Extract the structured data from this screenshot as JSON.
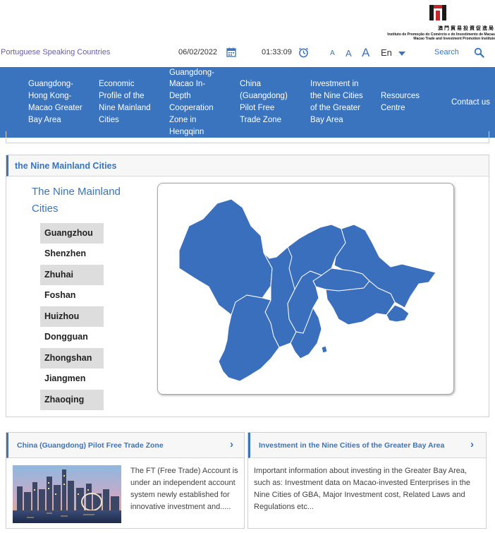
{
  "logo": {
    "chinese_name": "澳門貿易投資促進局",
    "portuguese_name": "Instituto de Promoção do Comércio e do Investimento de Macau",
    "english_name": "Macao Trade and Investment Promotion Institute"
  },
  "topbar": {
    "portuguese_link": "Portuguese Speaking Countries",
    "date": "06/02/2022",
    "time": "01:33:09",
    "font_small": "A",
    "font_medium": "A",
    "font_large": "A",
    "language": "En",
    "search_label": "Search"
  },
  "nav": {
    "items": [
      {
        "label": "Guangdong-Hong Kong-Macao Greater Bay Area"
      },
      {
        "label": "Economic Profile of the Nine Mainland Cities"
      },
      {
        "label": "Guangdong-Macao In-Depth Cooperation Zone in Hengqinn"
      },
      {
        "label": "China (Guangdong) Pilot Free Trade Zone"
      },
      {
        "label": "Investment in the Nine Cities of the Greater Bay Area"
      },
      {
        "label": "Resources Centre"
      },
      {
        "label": "Contact us"
      }
    ]
  },
  "cities_section": {
    "header": "the Nine Mainland Cities",
    "list_title": "The Nine Mainland Cities",
    "cities": [
      "Guangzhou",
      "Shenzhen",
      "Zhuhai",
      "Foshan",
      "Huizhou",
      "Dongguan",
      "Zhongshan",
      "Jiangmen",
      "Zhaoqing"
    ]
  },
  "cards": [
    {
      "title": "China (Guangdong) Pilot Free Trade Zone",
      "text": "The FT (Free Trade) Account is under an independent account system newly established for innovative investment and....."
    },
    {
      "title": "Investment in the Nine Cities of the Greater Bay Area",
      "text": "Important information about investing in the Greater Bay Area, such as: Investment data on Macao-invested Enterprises in the Nine Cities of GBA, Major Investment cost, Related Laws and Regulations etc..."
    }
  ],
  "colors": {
    "primary_blue": "#3a74bf",
    "link_purple": "#6a5da8",
    "map_fill": "#3a6fbd",
    "shade_gray": "#dddddd"
  },
  "icons": {
    "calendar": "calendar-icon",
    "clock": "clock-icon",
    "search": "search-icon",
    "language_caret": "chevron-down-icon",
    "card_chevron": "chevron-right-icon"
  }
}
